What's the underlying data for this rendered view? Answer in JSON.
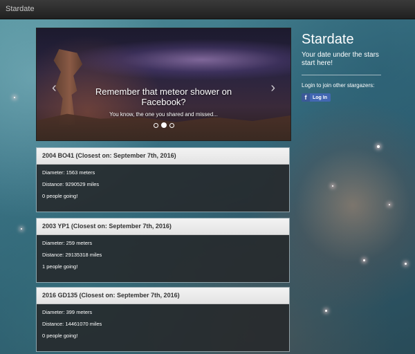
{
  "navbar": {
    "brand": "Stardate"
  },
  "carousel": {
    "title": "Remember that meteor shower on Facebook?",
    "subtitle": "You know, the one you shared and missed...",
    "slide_count": 3,
    "active_slide": 2
  },
  "sidebar": {
    "title": "Stardate",
    "tagline": "Your date under the stars start here!",
    "login_text": "Login to join other stargazers:",
    "login_button": "Log In",
    "fb_icon": "f"
  },
  "asteroids": [
    {
      "header": "2004 BO41 (Closest on: September 7th, 2016)",
      "diameter": "Diameter: 1563 meters",
      "distance": "Distance: 9290529 miles",
      "going": "0 people going!"
    },
    {
      "header": "2003 YP1 (Closest on: September 7th, 2016)",
      "diameter": "Diameter: 259 meters",
      "distance": "Distance: 29135318 miles",
      "going": "1 people going!"
    },
    {
      "header": "2016 GD135 (Closest on: September 7th, 2016)",
      "diameter": "Diameter: 399 meters",
      "distance": "Distance: 14461070 miles",
      "going": "0 people going!"
    }
  ],
  "colors": {
    "navbar": "#2a2a2a",
    "card_header": "#e8e8e8",
    "card_body": "#26282a",
    "facebook": "#4267b2"
  }
}
